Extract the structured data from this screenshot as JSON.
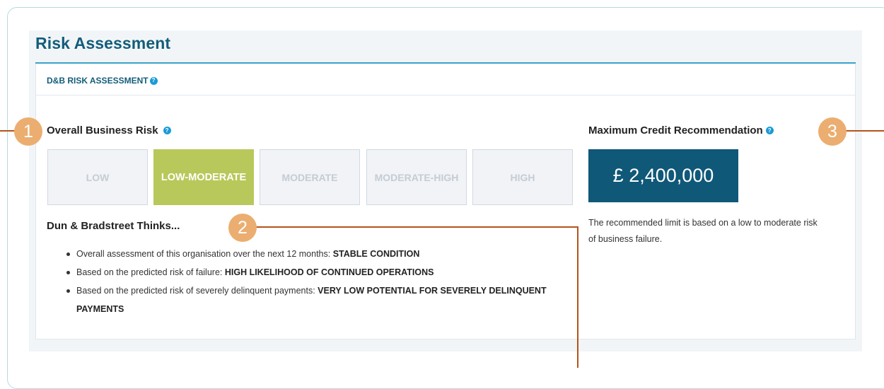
{
  "section": {
    "title": "Risk Assessment"
  },
  "card": {
    "header": "D&B RISK ASSESSMENT"
  },
  "overall_risk": {
    "title": "Overall Business Risk",
    "levels": [
      "LOW",
      "LOW-MODERATE",
      "MODERATE",
      "MODERATE-HIGH",
      "HIGH"
    ],
    "selected": "LOW-MODERATE"
  },
  "thinks": {
    "title": "Dun & Bradstreet Thinks...",
    "items": [
      {
        "text": "Overall assessment of this organisation over the next 12 months: ",
        "bold": "STABLE CONDITION"
      },
      {
        "text": "Based on the predicted risk of failure: ",
        "bold": "HIGH LIKELIHOOD OF CONTINUED OPERATIONS"
      },
      {
        "text": "Based on the predicted risk of severely delinquent payments: ",
        "bold": "VERY LOW POTENTIAL FOR SEVERELY DELINQUENT PAYMENTS"
      }
    ]
  },
  "credit": {
    "title": "Maximum Credit Recommendation",
    "value": "£ 2,400,000",
    "note": "The recommended limit is based on a low to moderate risk of business failure."
  },
  "callouts": {
    "one": "1",
    "two": "2",
    "three": "3"
  },
  "help_icon_glyph": "?",
  "colors": {
    "selected_risk": "#b9c85a",
    "credit_box": "#105878",
    "callout": "#ebae70",
    "leader_line": "#b5531a",
    "title_accent": "#135d7a"
  }
}
